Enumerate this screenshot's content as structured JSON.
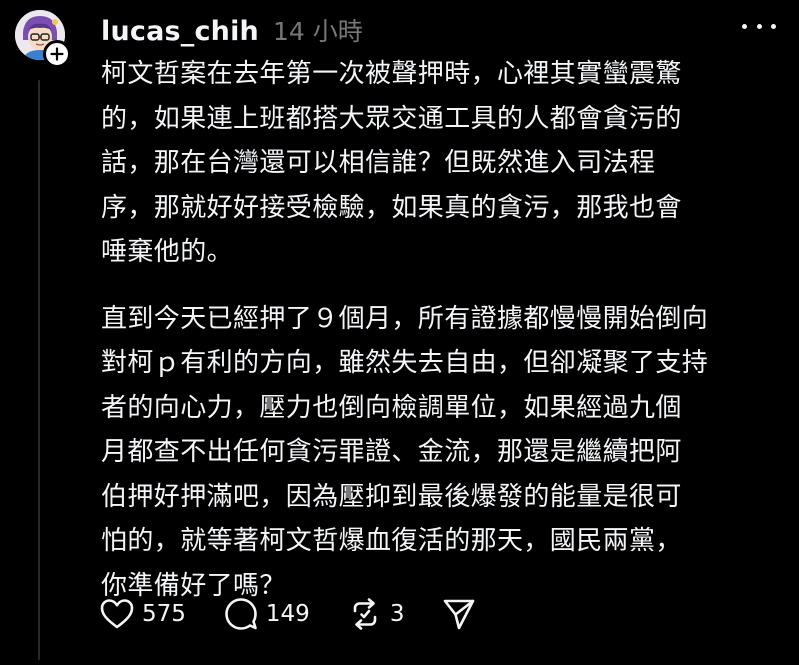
{
  "post": {
    "author": {
      "username": "lucas_chih",
      "avatar_icon": "cartoon-avatar",
      "follow_icon": "plus-icon"
    },
    "timestamp": "14 小時",
    "paragraphs": [
      "柯文哲案在去年第一次被聲押時，心裡其實蠻震驚\n的，如果連上班都搭大眾交通工具的人都會貪污的\n話，那在台灣還可以相信誰？但既然進入司法程\n序，那就好好接受檢驗，如果真的貪污，那我也會\n唾棄他的。",
      "直到今天已經押了９個月，所有證據都慢慢開始倒向\n對柯ｐ有利的方向，雖然失去自由，但卻凝聚了支持\n者的向心力，壓力也倒向檢調單位，如果經過九個\n月都查不出任何貪污罪證、金流，那還是繼續把阿\n伯押好押滿吧，因為壓抑到最後爆發的能量是很可\n怕的，就等著柯文哲爆血復活的那天，國民兩黨，\n你準備好了嗎？"
    ],
    "actions": {
      "like": {
        "icon": "heart-icon",
        "count": "575"
      },
      "reply": {
        "icon": "comment-icon",
        "count": "149"
      },
      "repost": {
        "icon": "repost-icon",
        "count": "3"
      },
      "share": {
        "icon": "send-icon"
      }
    },
    "more_icon": "more-icon"
  },
  "colors": {
    "background": "#000000",
    "text": "#f3f5f7",
    "muted": "#777777",
    "thread_line": "#2a2a2a"
  }
}
